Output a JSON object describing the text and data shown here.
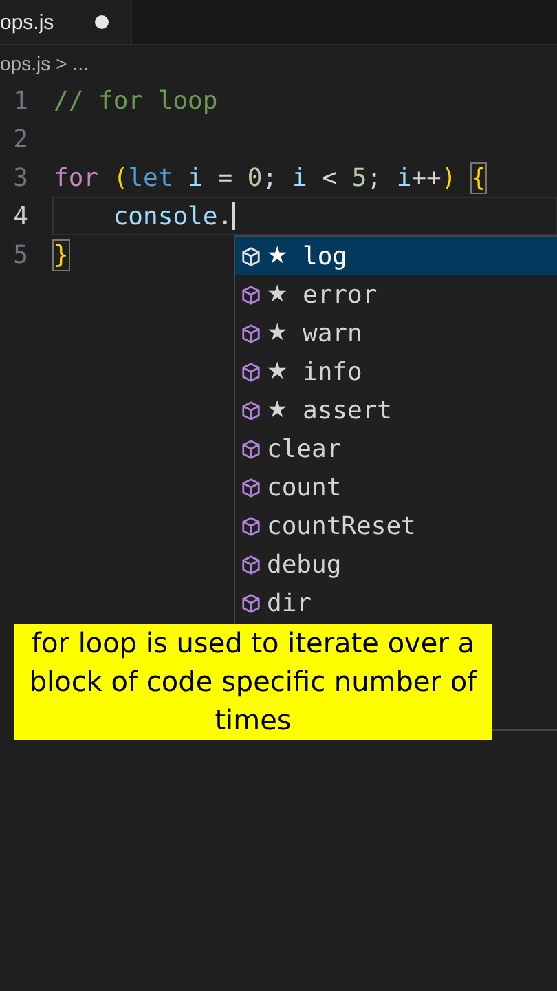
{
  "tab": {
    "label": "ops.js",
    "modified": true
  },
  "breadcrumb": {
    "file": "ops.js",
    "separator": ">",
    "rest": "..."
  },
  "lines": [
    {
      "number": "1",
      "current": false,
      "tokens": [
        {
          "text": "// for loop",
          "kind": "comment"
        }
      ]
    },
    {
      "number": "2",
      "current": false
    },
    {
      "number": "3",
      "current": false,
      "tokens": [
        {
          "text": "for",
          "kind": "keyword"
        },
        {
          "text": " (",
          "kind": "paren"
        },
        {
          "text": "let",
          "kind": "decl"
        },
        {
          "text": " i",
          "kind": "var"
        },
        {
          "text": " = ",
          "kind": "plain"
        },
        {
          "text": "0",
          "kind": "number"
        },
        {
          "text": "; ",
          "kind": "plain"
        },
        {
          "text": "i",
          "kind": "var"
        },
        {
          "text": " < ",
          "kind": "plain"
        },
        {
          "text": "5",
          "kind": "number"
        },
        {
          "text": "; ",
          "kind": "plain"
        },
        {
          "text": "i",
          "kind": "var"
        },
        {
          "text": "++",
          "kind": "plain"
        },
        {
          "text": ") ",
          "kind": "paren"
        },
        {
          "text": "{",
          "kind": "brace-match"
        }
      ]
    },
    {
      "number": "4",
      "current": true,
      "tokens": [
        {
          "text": "    console",
          "kind": "var"
        },
        {
          "text": ".",
          "kind": "plain"
        }
      ]
    },
    {
      "number": "5",
      "current": false,
      "tokens": [
        {
          "text": "}",
          "kind": "brace-match"
        }
      ]
    }
  ],
  "suggestions": [
    {
      "label": "log",
      "star": "★",
      "selected": true
    },
    {
      "label": "error",
      "star": "★",
      "selected": false
    },
    {
      "label": "warn",
      "star": "★",
      "selected": false
    },
    {
      "label": "info",
      "star": "★",
      "selected": false
    },
    {
      "label": "assert",
      "star": "★",
      "selected": false
    },
    {
      "label": "clear",
      "selected": false
    },
    {
      "label": "count",
      "selected": false
    },
    {
      "label": "countReset",
      "selected": false
    },
    {
      "label": "debug",
      "selected": false
    },
    {
      "label": "dir",
      "selected": false
    }
  ],
  "caption": "for loop is used to iterate over a block of code specific number of times"
}
